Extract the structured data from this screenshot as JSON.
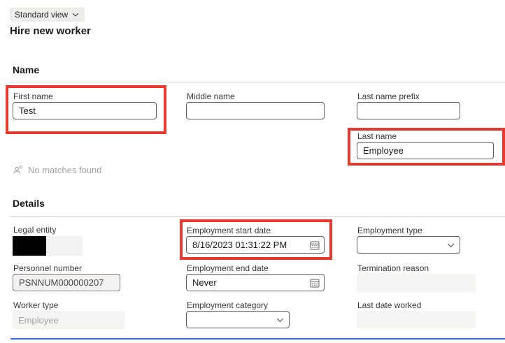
{
  "header": {
    "view_selector_label": "Standard view",
    "page_title": "Hire new worker"
  },
  "name_section": {
    "title": "Name",
    "first_name": {
      "label": "First name",
      "value": "Test"
    },
    "middle_name": {
      "label": "Middle name",
      "value": ""
    },
    "last_name_prefix": {
      "label": "Last name prefix",
      "value": ""
    },
    "last_name": {
      "label": "Last name",
      "value": "Employee"
    },
    "no_matches_text": "No matches found"
  },
  "details_section": {
    "title": "Details",
    "legal_entity": {
      "label": "Legal entity",
      "value": ""
    },
    "employment_start_date": {
      "label": "Employment start date",
      "value": "8/16/2023 01:31:22 PM"
    },
    "employment_type": {
      "label": "Employment type",
      "value": ""
    },
    "personnel_number": {
      "label": "Personnel number",
      "value": "PSNNUM000000207"
    },
    "employment_end_date": {
      "label": "Employment end date",
      "value": "Never"
    },
    "termination_reason": {
      "label": "Termination reason",
      "value": ""
    },
    "worker_type": {
      "label": "Worker type",
      "value": "Employee"
    },
    "employment_category": {
      "label": "Employment category",
      "value": ""
    },
    "last_date_worked": {
      "label": "Last date worked",
      "value": ""
    }
  },
  "icons": {
    "chevron_down": "chevron-down",
    "calendar": "calendar",
    "person_search": "person-search"
  },
  "colors": {
    "annotation_red": "#e8392f",
    "accent_blue": "#2e6bd6",
    "disabled_bg": "#f5f5f4",
    "pill_bg": "#ededeb"
  }
}
